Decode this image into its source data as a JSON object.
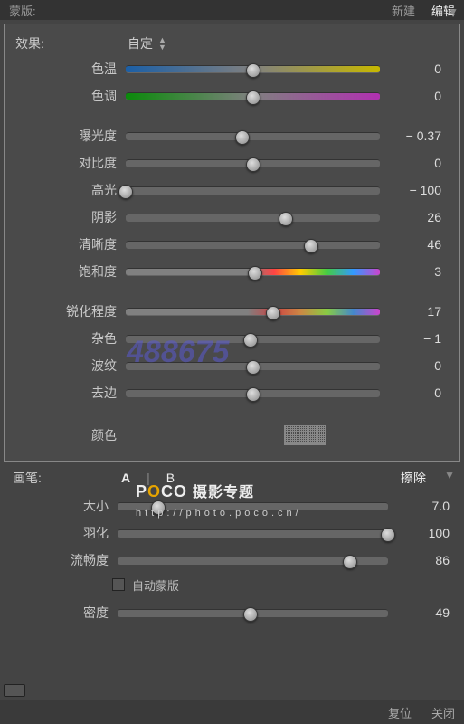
{
  "topbar": {
    "left": "蒙版:",
    "right1": "新建",
    "right2": "编辑"
  },
  "effects": {
    "title": "效果:",
    "preset": "自定",
    "sliders": [
      {
        "key": "temp",
        "label": "色温",
        "value": 0,
        "pos": 50,
        "grad": "grad-temp"
      },
      {
        "key": "tint",
        "label": "色调",
        "value": 0,
        "pos": 50,
        "grad": "grad-tint"
      },
      {
        "key": "gap",
        "gap": true
      },
      {
        "key": "exposure",
        "label": "曝光度",
        "value": "− 0.37",
        "pos": 46,
        "grad": "grad-flat"
      },
      {
        "key": "contrast",
        "label": "对比度",
        "value": 0,
        "pos": 50,
        "grad": "grad-flat"
      },
      {
        "key": "highlights",
        "label": "高光",
        "value": "− 100",
        "pos": 0,
        "grad": "grad-flat"
      },
      {
        "key": "shadows",
        "label": "阴影",
        "value": 26,
        "pos": 63,
        "grad": "grad-flat"
      },
      {
        "key": "clarity",
        "label": "清晰度",
        "value": 46,
        "pos": 73,
        "grad": "grad-flat"
      },
      {
        "key": "saturation",
        "label": "饱和度",
        "value": 3,
        "pos": 51,
        "grad": "grad-sat"
      },
      {
        "key": "gap2",
        "gap": true
      },
      {
        "key": "sharp",
        "label": "锐化程度",
        "value": 17,
        "pos": 58,
        "grad": "grad-sharp"
      },
      {
        "key": "noise",
        "label": "杂色",
        "value": "− 1",
        "pos": 49,
        "grad": "grad-flat"
      },
      {
        "key": "moire",
        "label": "波纹",
        "value": 0,
        "pos": 50,
        "grad": "grad-flat"
      },
      {
        "key": "defringe",
        "label": "去边",
        "value": 0,
        "pos": 50,
        "grad": "grad-flat"
      }
    ],
    "colorLabel": "颜色"
  },
  "brush": {
    "title": "画笔:",
    "a": "A",
    "b": "B",
    "erase": "擦除",
    "sliders": [
      {
        "key": "size",
        "label": "大小",
        "value": "7.0",
        "pos": 15
      },
      {
        "key": "feather",
        "label": "羽化",
        "value": 100,
        "pos": 100
      },
      {
        "key": "flow",
        "label": "流畅度",
        "value": 86,
        "pos": 86
      }
    ],
    "automask": "自动蒙版",
    "density": {
      "label": "密度",
      "value": 49,
      "pos": 49
    }
  },
  "bottom": {
    "left": "",
    "btn1": "复位",
    "btn2": "关闭"
  },
  "watermark": "488675",
  "wm2": {
    "brand": "POCO",
    "tag": "摄影专题",
    "url": "http://photo.poco.cn/"
  }
}
